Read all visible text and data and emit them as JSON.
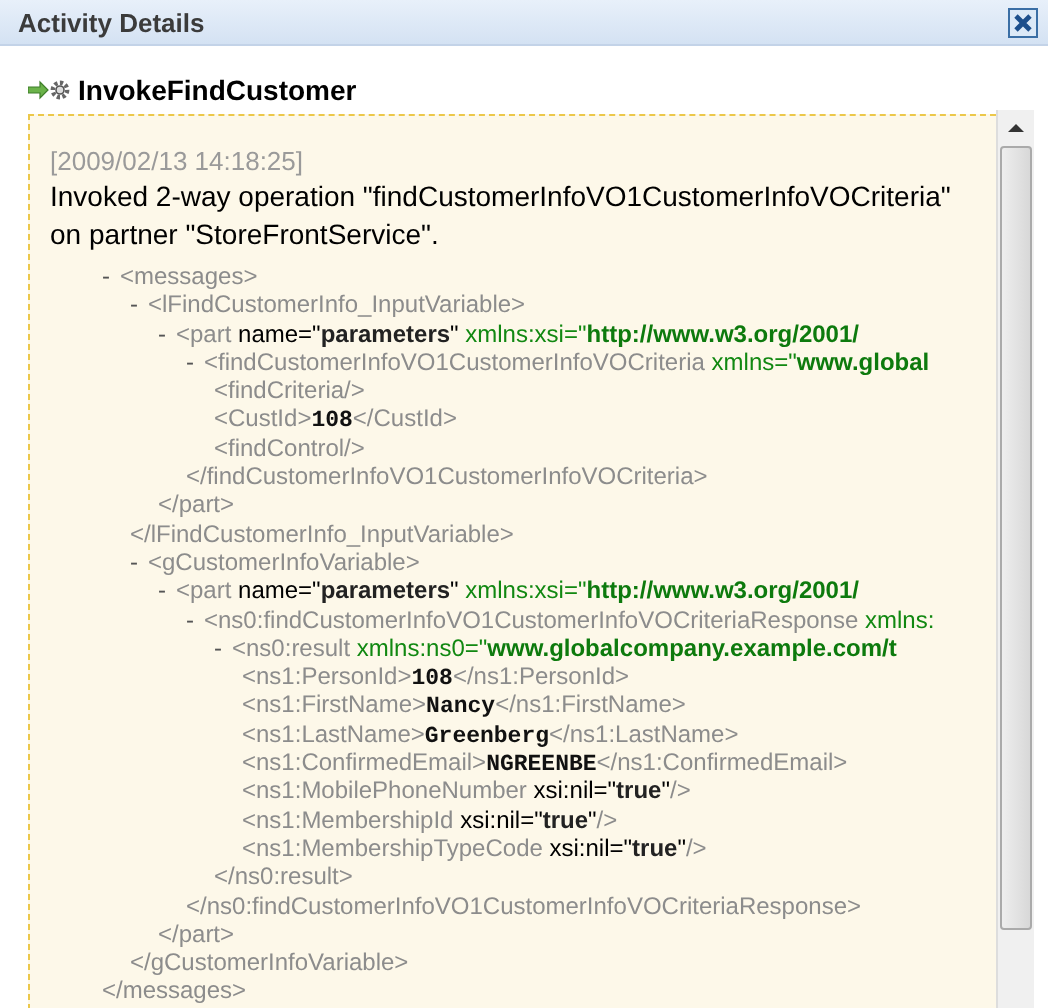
{
  "window": {
    "title": "Activity Details"
  },
  "activity": {
    "name": "InvokeFindCustomer",
    "timestamp": "[2009/02/13 14:18:25]",
    "message": "Invoked 2-way operation \"findCustomerInfoVO1CustomerInfoVOCriteria\" on partner \"StoreFrontService\"."
  },
  "xml": [
    {
      "toggle": "-",
      "open": [
        {
          "kind": "tag",
          "text": "<messages>"
        }
      ],
      "close": "</messages>",
      "children": [
        {
          "toggle": "-",
          "open": [
            {
              "kind": "tag",
              "text": "<lFindCustomerInfo_InputVariable>"
            }
          ],
          "close": "</lFindCustomerInfo_InputVariable>",
          "children": [
            {
              "toggle": "-",
              "open": [
                {
                  "kind": "tag",
                  "text": "<part "
                },
                {
                  "kind": "attr",
                  "text": "name=\""
                },
                {
                  "kind": "value",
                  "text": "parameters"
                },
                {
                  "kind": "attr",
                  "text": "\" "
                },
                {
                  "kind": "ns",
                  "text": "xmlns:xsi=\""
                },
                {
                  "kind": "uri",
                  "text": "http://www.w3.org/2001/"
                }
              ],
              "close": "</part>",
              "children": [
                {
                  "toggle": "-",
                  "open": [
                    {
                      "kind": "tag",
                      "text": "<findCustomerInfoVO1CustomerInfoVOCriteria "
                    },
                    {
                      "kind": "ns",
                      "text": "xmlns=\""
                    },
                    {
                      "kind": "uri",
                      "text": "www.global"
                    }
                  ],
                  "close": "</findCustomerInfoVO1CustomerInfoVOCriteria>",
                  "children": [
                    {
                      "open": [
                        {
                          "kind": "tag",
                          "text": "<findCriteria/>"
                        }
                      ]
                    },
                    {
                      "open": [
                        {
                          "kind": "tag",
                          "text": "<CustId>"
                        },
                        {
                          "kind": "data",
                          "text": "108"
                        },
                        {
                          "kind": "tag",
                          "text": "</CustId>"
                        }
                      ]
                    },
                    {
                      "open": [
                        {
                          "kind": "tag",
                          "text": "<findControl/>"
                        }
                      ]
                    }
                  ]
                }
              ]
            }
          ]
        },
        {
          "toggle": "-",
          "open": [
            {
              "kind": "tag",
              "text": "<gCustomerInfoVariable>"
            }
          ],
          "close": "</gCustomerInfoVariable>",
          "children": [
            {
              "toggle": "-",
              "open": [
                {
                  "kind": "tag",
                  "text": "<part "
                },
                {
                  "kind": "attr",
                  "text": "name=\""
                },
                {
                  "kind": "value",
                  "text": "parameters"
                },
                {
                  "kind": "attr",
                  "text": "\" "
                },
                {
                  "kind": "ns",
                  "text": "xmlns:xsi=\""
                },
                {
                  "kind": "uri",
                  "text": "http://www.w3.org/2001/"
                }
              ],
              "close": "</part>",
              "children": [
                {
                  "toggle": "-",
                  "open": [
                    {
                      "kind": "tag",
                      "text": "<ns0:findCustomerInfoVO1CustomerInfoVOCriteriaResponse "
                    },
                    {
                      "kind": "ns",
                      "text": "xmlns:"
                    }
                  ],
                  "close": "</ns0:findCustomerInfoVO1CustomerInfoVOCriteriaResponse>",
                  "children": [
                    {
                      "toggle": "-",
                      "open": [
                        {
                          "kind": "tag",
                          "text": "<ns0:result "
                        },
                        {
                          "kind": "ns",
                          "text": "xmlns:ns0=\""
                        },
                        {
                          "kind": "uri",
                          "text": "www.globalcompany.example.com/t"
                        }
                      ],
                      "close": "</ns0:result>",
                      "children": [
                        {
                          "open": [
                            {
                              "kind": "tag",
                              "text": "<ns1:PersonId>"
                            },
                            {
                              "kind": "data",
                              "text": "108"
                            },
                            {
                              "kind": "tag",
                              "text": "</ns1:PersonId>"
                            }
                          ]
                        },
                        {
                          "open": [
                            {
                              "kind": "tag",
                              "text": "<ns1:FirstName>"
                            },
                            {
                              "kind": "data",
                              "text": "Nancy"
                            },
                            {
                              "kind": "tag",
                              "text": "</ns1:FirstName>"
                            }
                          ]
                        },
                        {
                          "open": [
                            {
                              "kind": "tag",
                              "text": "<ns1:LastName>"
                            },
                            {
                              "kind": "data",
                              "text": "Greenberg"
                            },
                            {
                              "kind": "tag",
                              "text": "</ns1:LastName>"
                            }
                          ]
                        },
                        {
                          "open": [
                            {
                              "kind": "tag",
                              "text": "<ns1:ConfirmedEmail>"
                            },
                            {
                              "kind": "data",
                              "text": "NGREENBE"
                            },
                            {
                              "kind": "tag",
                              "text": "</ns1:ConfirmedEmail>"
                            }
                          ]
                        },
                        {
                          "open": [
                            {
                              "kind": "tag",
                              "text": "<ns1:MobilePhoneNumber "
                            },
                            {
                              "kind": "attr",
                              "text": "xsi:nil=\""
                            },
                            {
                              "kind": "value",
                              "text": "true"
                            },
                            {
                              "kind": "attr",
                              "text": "\""
                            },
                            {
                              "kind": "tag",
                              "text": "/>"
                            }
                          ]
                        },
                        {
                          "open": [
                            {
                              "kind": "tag",
                              "text": "<ns1:MembershipId "
                            },
                            {
                              "kind": "attr",
                              "text": "xsi:nil=\""
                            },
                            {
                              "kind": "value",
                              "text": "true"
                            },
                            {
                              "kind": "attr",
                              "text": "\""
                            },
                            {
                              "kind": "tag",
                              "text": "/>"
                            }
                          ]
                        },
                        {
                          "open": [
                            {
                              "kind": "tag",
                              "text": "<ns1:MembershipTypeCode "
                            },
                            {
                              "kind": "attr",
                              "text": "xsi:nil=\""
                            },
                            {
                              "kind": "value",
                              "text": "true"
                            },
                            {
                              "kind": "attr",
                              "text": "\""
                            },
                            {
                              "kind": "tag",
                              "text": "/>"
                            }
                          ]
                        }
                      ]
                    }
                  ]
                }
              ]
            }
          ]
        }
      ]
    }
  ]
}
